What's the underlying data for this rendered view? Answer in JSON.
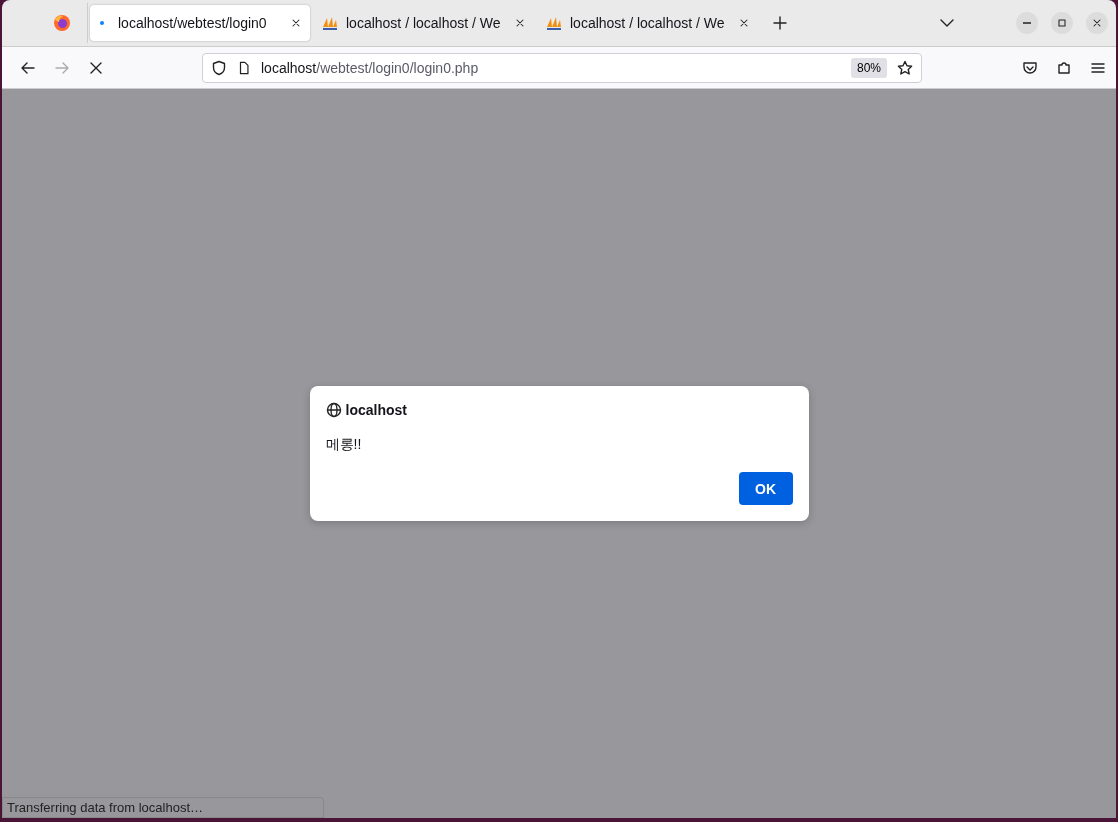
{
  "tabs": [
    {
      "label": "localhost/webtest/login0",
      "kind": "loading",
      "selected": true
    },
    {
      "label": "localhost / localhost / We",
      "kind": "pma",
      "selected": false
    },
    {
      "label": "localhost / localhost / We",
      "kind": "pma",
      "selected": false
    }
  ],
  "address_bar": {
    "host": "localhost",
    "path": "/webtest/login0/login0.php",
    "zoom": "80%"
  },
  "dialog": {
    "title": "localhost",
    "message": "메롱!!",
    "button": "OK"
  },
  "status_bar": "Transferring data from localhost…"
}
